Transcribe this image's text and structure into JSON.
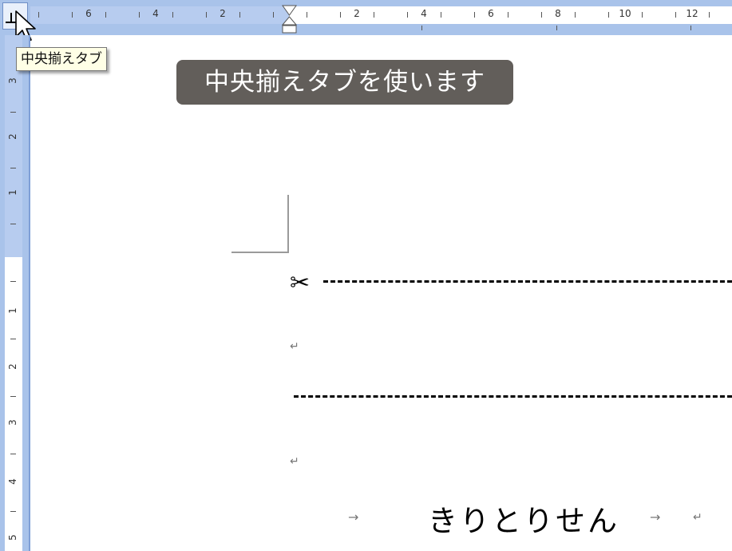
{
  "tooltip": {
    "text": "中央揃えタブ"
  },
  "banner": {
    "text": "中央揃えタブを使います"
  },
  "ruler": {
    "horizontal_labels_left": [
      "6",
      "4",
      "2"
    ],
    "horizontal_labels_right": [
      "2",
      "4",
      "6",
      "8",
      "10",
      "12"
    ],
    "vertical_labels_margin": [
      "3",
      "2",
      "1"
    ],
    "vertical_labels_body": [
      "1",
      "2",
      "3",
      "4",
      "5"
    ]
  },
  "document": {
    "scissors_icon": "✂",
    "cut_line_text": "きりとりせん",
    "paragraph_mark": "↵",
    "tab_arrow": "→"
  },
  "colors": {
    "ruler_bg": "#a9c3ea",
    "banner_bg": "#625e5a",
    "tooltip_bg": "#ffffe6"
  }
}
